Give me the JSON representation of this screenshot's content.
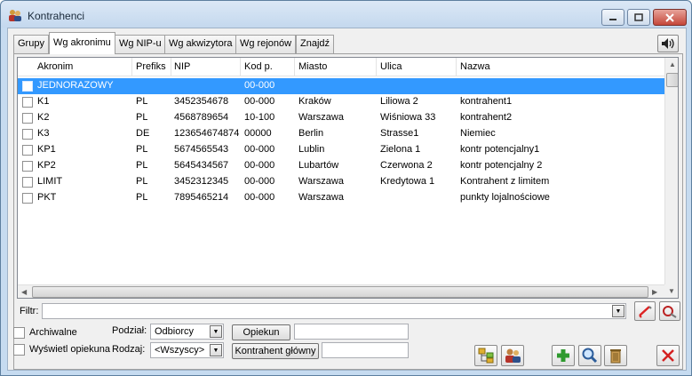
{
  "window": {
    "title": "Kontrahenci"
  },
  "tabs": [
    {
      "label": "Grupy"
    },
    {
      "label": "Wg akronimu"
    },
    {
      "label": "Wg NIP-u"
    },
    {
      "label": "Wg akwizytora"
    },
    {
      "label": "Wg rejonów"
    },
    {
      "label": "Znajdź"
    }
  ],
  "grid": {
    "columns": [
      "Akronim",
      "Prefiks",
      "NIP",
      "Kod p.",
      "Miasto",
      "Ulica",
      "Nazwa"
    ],
    "rows": [
      {
        "akronim": "JEDNORAZOWY",
        "prefiks": "",
        "nip": "",
        "kod": "00-000",
        "miasto": "",
        "ulica": "",
        "nazwa": ""
      },
      {
        "akronim": "K1",
        "prefiks": "PL",
        "nip": "3452354678",
        "kod": "00-000",
        "miasto": "Kraków",
        "ulica": "Liliowa 2",
        "nazwa": "kontrahent1"
      },
      {
        "akronim": "K2",
        "prefiks": "PL",
        "nip": "4568789654",
        "kod": "10-100",
        "miasto": "Warszawa",
        "ulica": "Wiśniowa 33",
        "nazwa": "kontrahent2"
      },
      {
        "akronim": "K3",
        "prefiks": "DE",
        "nip": "123654674874",
        "kod": "00000",
        "miasto": "Berlin",
        "ulica": "Strasse1",
        "nazwa": "Niemiec"
      },
      {
        "akronim": "KP1",
        "prefiks": "PL",
        "nip": "5674565543",
        "kod": "00-000",
        "miasto": "Lublin",
        "ulica": "Zielona 1",
        "nazwa": "kontr potencjalny1"
      },
      {
        "akronim": "KP2",
        "prefiks": "PL",
        "nip": "5645434567",
        "kod": "00-000",
        "miasto": "Lubartów",
        "ulica": "Czerwona 2",
        "nazwa": "kontr potencjalny 2"
      },
      {
        "akronim": "LIMIT",
        "prefiks": "PL",
        "nip": "3452312345",
        "kod": "00-000",
        "miasto": "Warszawa",
        "ulica": "Kredytowa 1",
        "nazwa": "Kontrahent z limitem"
      },
      {
        "akronim": "PKT",
        "prefiks": "PL",
        "nip": "7895465214",
        "kod": "00-000",
        "miasto": "Warszawa",
        "ulica": "",
        "nazwa": "punkty lojalnościowe"
      }
    ]
  },
  "filter": {
    "label": "Filtr:",
    "value": ""
  },
  "bottom": {
    "archiwalne_label": "Archiwalne",
    "wyswietl_label": "Wyświetl opiekuna",
    "podzial_label": "Podział:",
    "podzial_value": "Odbiorcy",
    "rodzaj_label": "Rodzaj:",
    "rodzaj_value": "<Wszyscy>",
    "opiekun_button": "Opiekun",
    "opiekun_value": "",
    "kontrahent_glowny_button": "Kontrahent główny",
    "kontrahent_glowny_value": ""
  },
  "colors": {
    "selection": "#3399ff",
    "window_frame": "#c6dbf0",
    "close_button": "#c5473a"
  }
}
